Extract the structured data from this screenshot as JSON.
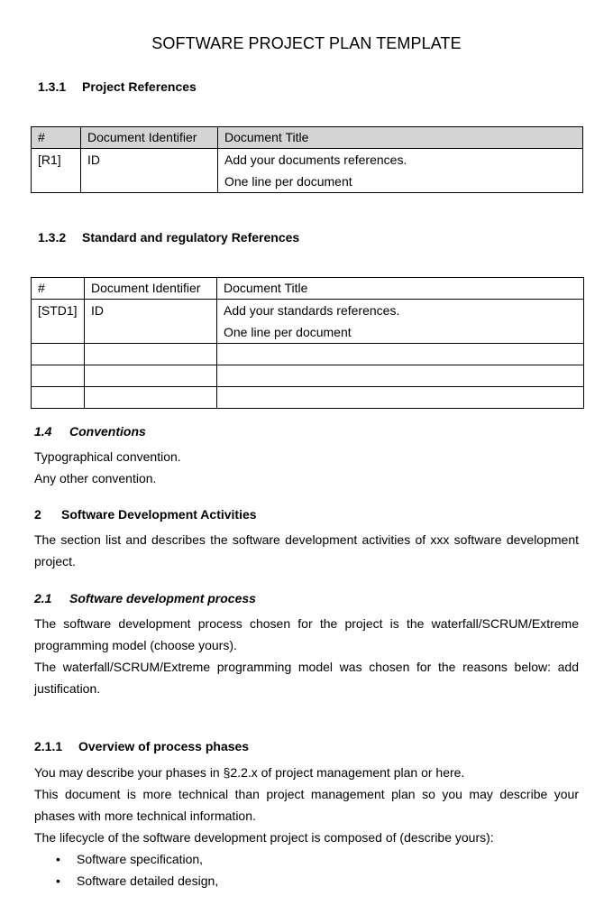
{
  "title": "SOFTWARE PROJECT PLAN TEMPLATE",
  "sec_131": {
    "number": "1.3.1",
    "heading": "Project References",
    "table": {
      "headers": [
        "#",
        "Document Identifier",
        "Document Title"
      ],
      "rows": [
        {
          "id": "[R1]",
          "identifier": "ID",
          "title_line1": "Add your documents references.",
          "title_line2": "One line per document"
        }
      ]
    }
  },
  "sec_132": {
    "number": "1.3.2",
    "heading": "Standard and regulatory References",
    "table": {
      "headers": [
        "#",
        "Document Identifier",
        "Document Title"
      ],
      "rows": [
        {
          "id": "[STD1]",
          "identifier": "ID",
          "title_line1": "Add your standards references.",
          "title_line2": "One line per document"
        }
      ],
      "empty_rows": 3
    }
  },
  "sec_14": {
    "number": "1.4",
    "heading": "Conventions",
    "lines": [
      "Typographical convention.",
      "Any other convention."
    ]
  },
  "sec_2": {
    "number": "2",
    "heading": "Software Development Activities",
    "paragraph": "The section list and describes the software development activities of xxx software development project."
  },
  "sec_21": {
    "number": "2.1",
    "heading": "Software development process",
    "paragraph1": "The software development process chosen for the project is the waterfall/SCRUM/Extreme programming model (choose yours).",
    "paragraph2": "The waterfall/SCRUM/Extreme programming model was chosen for the reasons below: add justification."
  },
  "sec_211": {
    "number": "2.1.1",
    "heading": "Overview of process phases",
    "paragraph1": "You may describe your phases in §2.2.x of project management plan or here.",
    "paragraph2": "This document is more technical than project management plan so you may describe your phases with more technical information.",
    "paragraph3": "The lifecycle of the software development project is composed of (describe yours):",
    "bullet_glyph": "•",
    "bullets": [
      "Software specification,",
      "Software detailed design,"
    ]
  }
}
